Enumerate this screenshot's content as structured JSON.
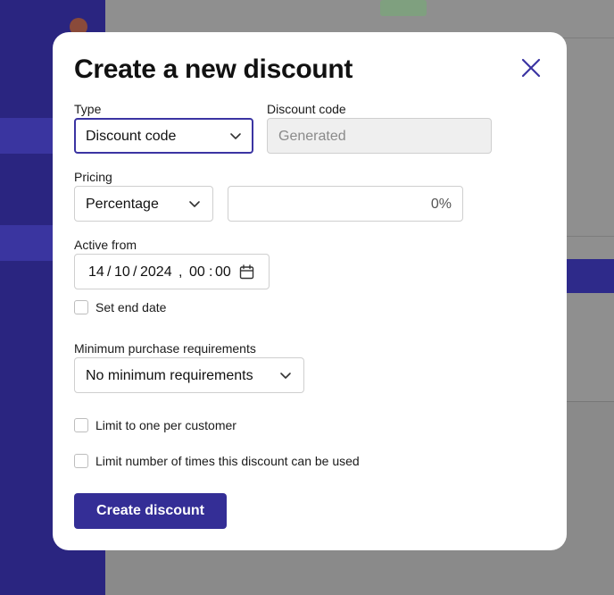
{
  "modal": {
    "title": "Create a new discount",
    "type": {
      "label": "Type",
      "value": "Discount code"
    },
    "discount_code": {
      "label": "Discount code",
      "value": "Generated"
    },
    "pricing": {
      "label": "Pricing",
      "value": "Percentage",
      "amount_suffix": "0%"
    },
    "active_from": {
      "label": "Active from",
      "day": "14",
      "month": "10",
      "year": "2024",
      "date_sep": "/",
      "time_sep_comma": ",",
      "hour": "00",
      "minute": "00",
      "time_sep": ":"
    },
    "set_end_date": {
      "label": "Set end date",
      "checked": false
    },
    "minimum_purchase": {
      "label": "Minimum purchase requirements",
      "value": "No minimum requirements"
    },
    "limit_one_per_customer": {
      "label": "Limit to one per customer",
      "checked": false
    },
    "limit_usage": {
      "label": "Limit number of times this discount can be used",
      "checked": false
    },
    "submit_label": "Create discount"
  },
  "colors": {
    "accent": "#342e96",
    "focus_border": "#3b34a2",
    "close_icon": "#3b34a2"
  },
  "icons": {
    "close": "close-icon",
    "chevron": "chevron-down-icon",
    "calendar": "calendar-icon"
  }
}
